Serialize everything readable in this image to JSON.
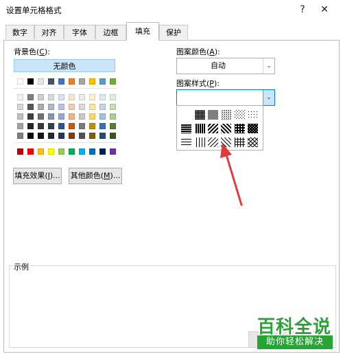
{
  "window": {
    "title": "设置单元格格式",
    "help": "?",
    "close": "✕"
  },
  "tabs": [
    {
      "label": "数字"
    },
    {
      "label": "对齐"
    },
    {
      "label": "字体"
    },
    {
      "label": "边框"
    },
    {
      "label": "填充",
      "active": true
    },
    {
      "label": "保护"
    }
  ],
  "fill": {
    "background_label": "背景色(",
    "background_key": "C",
    "background_label_end": "):",
    "no_color": "无颜色",
    "fill_effects": "填充效果(",
    "fill_effects_key": "I",
    "fill_effects_end": ")...",
    "more_colors": "其他颜色(",
    "more_colors_key": "M",
    "more_colors_end": ")..."
  },
  "pattern": {
    "color_label": "图案颜色(",
    "color_key": "A",
    "color_label_end": "):",
    "color_value": "自动",
    "style_label": "图案样式(",
    "style_key": "P",
    "style_label_end": "):"
  },
  "sample": {
    "label": "示例"
  },
  "palette": {
    "theme_top": [
      "#ffffff",
      "#000000",
      "#e7e6e6",
      "#44546a",
      "#4472c4",
      "#ed7d31",
      "#a5a5a5",
      "#ffc000",
      "#5b9bd5",
      "#70ad47"
    ],
    "theme_shades": [
      [
        "#f2f2f2",
        "#7f7f7f",
        "#d0cece",
        "#d6dce4",
        "#d9e2f3",
        "#fbe5d5",
        "#ededed",
        "#fff2cc",
        "#deebf6",
        "#e2efd9"
      ],
      [
        "#d8d8d8",
        "#595959",
        "#aeabab",
        "#adb9ca",
        "#b4c6e7",
        "#f7cbac",
        "#dbdbdb",
        "#fee599",
        "#bdd7ee",
        "#c5e0b3"
      ],
      [
        "#bfbfbf",
        "#3f3f3f",
        "#757070",
        "#8496b0",
        "#8eaadb",
        "#f4b183",
        "#c9c9c9",
        "#ffd965",
        "#9dc3e6",
        "#a8d08d"
      ],
      [
        "#a5a5a5",
        "#262626",
        "#3a3838",
        "#323f4f",
        "#2f5496",
        "#c55a11",
        "#7b7b7b",
        "#bf9000",
        "#2e75b5",
        "#538135"
      ],
      [
        "#7f7f7f",
        "#0c0c0c",
        "#171616",
        "#222a35",
        "#1e3864",
        "#833c0b",
        "#525252",
        "#7f6000",
        "#1e4e79",
        "#375623"
      ]
    ],
    "standard": [
      "#c00000",
      "#ff0000",
      "#ffc000",
      "#ffff00",
      "#92d050",
      "#00b050",
      "#00b0f0",
      "#0070c0",
      "#002060",
      "#7030a0"
    ]
  },
  "watermark": {
    "title": "百科全说",
    "subtitle": "助你轻松解决"
  }
}
